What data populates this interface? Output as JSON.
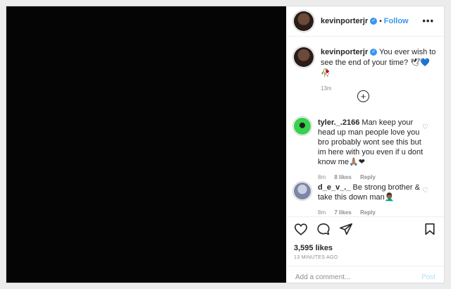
{
  "post": {
    "author": "kevinporterjr",
    "follow_label": "Follow",
    "separator": "•",
    "more_label": "•••"
  },
  "caption": {
    "username": "kevinporterjr",
    "text": "You ever wish to see the end of your time? 🕊💙🥀",
    "age": "13m"
  },
  "expand_label": "+",
  "comments": [
    {
      "username": "tyler._.2166",
      "text": "Man keep your head up man people love you bro probably wont see this but im here with you even if u dont know me🙏🏽❤",
      "age": "8m",
      "likes": "8 likes",
      "reply": "Reply"
    },
    {
      "username": "d_e_v_._",
      "text": "Be strong brother & take this down man🤦🏾‍♂️",
      "age": "8m",
      "likes": "7 likes",
      "reply": "Reply"
    }
  ],
  "likes": "3,595 likes",
  "timestamp": "13 MINUTES AGO",
  "add_comment": {
    "placeholder": "Add a comment...",
    "post_label": "Post"
  },
  "colors": {
    "link": "#3897f0",
    "verified": "#3897f0",
    "muted": "#8e8e8e",
    "media": "#050505"
  }
}
